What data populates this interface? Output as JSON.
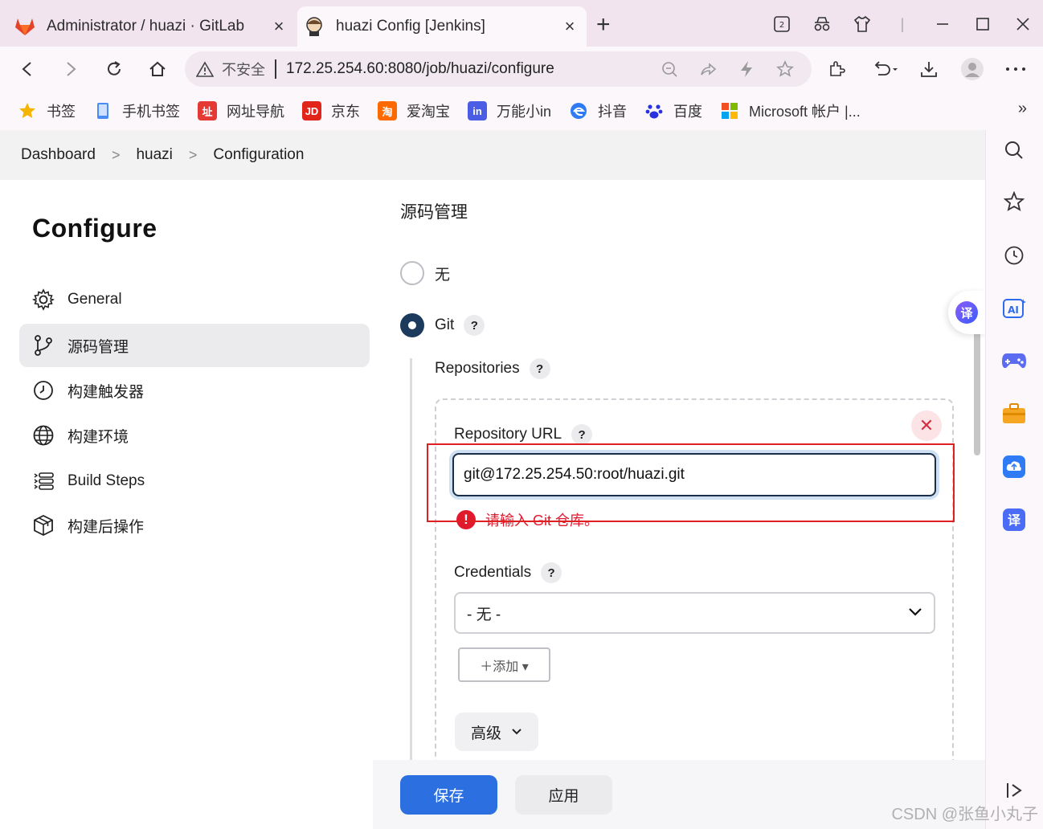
{
  "tabs": [
    {
      "title": "Administrator / huazi · GitLab",
      "icon": "gitlab-icon",
      "active": false
    },
    {
      "title": "huazi Config [Jenkins]",
      "icon": "jenkins-icon",
      "active": true
    }
  ],
  "window": {
    "tab_count_badge": "2"
  },
  "address_bar": {
    "insecure_label": "不安全",
    "url": "172.25.254.60:8080/job/huazi/configure"
  },
  "bookmarks": [
    {
      "label": "书签",
      "color": "#f5b400"
    },
    {
      "label": "手机书签",
      "color": "#4a8cf7"
    },
    {
      "label": "网址导航",
      "color": "#e53935"
    },
    {
      "label": "京东",
      "color": "#e1251b"
    },
    {
      "label": "爱淘宝",
      "color": "#ff6a00"
    },
    {
      "label": "万能小in",
      "color": "#4b5de4"
    },
    {
      "label": "抖音",
      "color": "#2f7bf6"
    },
    {
      "label": "百度",
      "color": "#2932e1"
    },
    {
      "label": "Microsoft 帐户 |...",
      "color": "#f25022"
    }
  ],
  "breadcrumb": [
    "Dashboard",
    "huazi",
    "Configuration"
  ],
  "sidebar": {
    "title": "Configure",
    "items": [
      {
        "label": "General",
        "icon": "gear-icon"
      },
      {
        "label": "源码管理",
        "icon": "branch-icon",
        "selected": true
      },
      {
        "label": "构建触发器",
        "icon": "timer-icon"
      },
      {
        "label": "构建环境",
        "icon": "globe-icon"
      },
      {
        "label": "Build Steps",
        "icon": "list-icon"
      },
      {
        "label": "构建后操作",
        "icon": "package-icon"
      }
    ]
  },
  "scm": {
    "title": "源码管理",
    "options": [
      {
        "label": "无",
        "checked": false
      },
      {
        "label": "Git",
        "checked": true
      }
    ],
    "help_glyph": "?",
    "repositories_label": "Repositories",
    "repository_url_label": "Repository URL",
    "repository_url_value": "git@172.25.254.50:root/huazi.git",
    "error_text": "请输入 Git 仓库。",
    "credentials_label": "Credentials",
    "credentials_value": "- 无 -",
    "add_button": "＋添加 ▾",
    "advanced_button": "高级"
  },
  "actions": {
    "save": "保存",
    "apply": "应用"
  },
  "watermark": "CSDN @张鱼小丸子",
  "colors": {
    "primary": "#2c6fe0",
    "error": "#e1192d",
    "radio_checked": "#1c3a5c"
  }
}
